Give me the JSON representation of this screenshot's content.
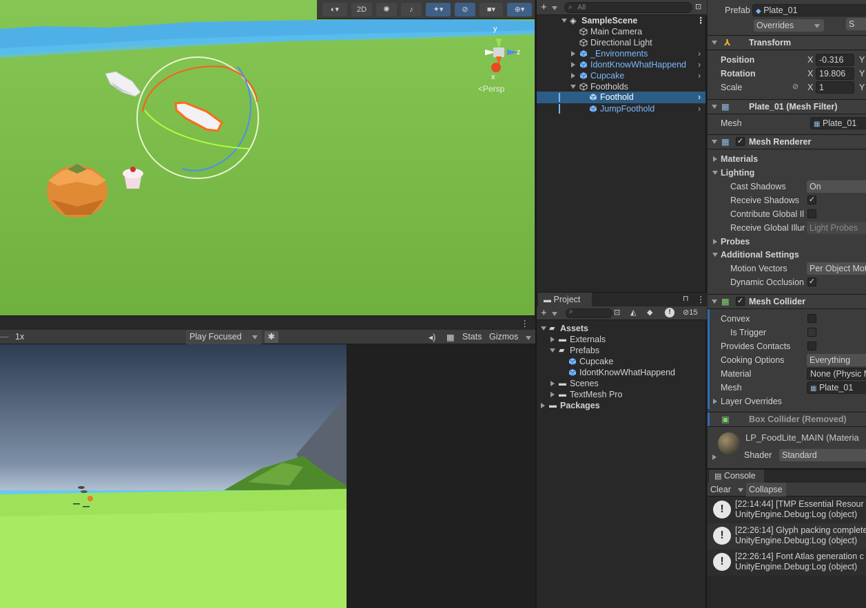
{
  "scene_toolbar": {
    "btn_2d": "2D",
    "hidden_count": "15"
  },
  "gizmo": {
    "y": "y",
    "z": "z",
    "x": "x",
    "persp": "<Persp"
  },
  "game_toolbar": {
    "scale": "1x",
    "play_mode": "Play Focused",
    "stats": "Stats",
    "gizmos": "Gizmos"
  },
  "hierarchy": {
    "search_placeholder": "All",
    "scene": "SampleScene",
    "items": [
      {
        "label": "Main Camera"
      },
      {
        "label": "Directional Light"
      },
      {
        "label": "_Environments"
      },
      {
        "label": "IdontKnowWhatHappend"
      },
      {
        "label": "Cupcake"
      },
      {
        "label": "Footholds"
      },
      {
        "label": "Foothold"
      },
      {
        "label": "JumpFoothold"
      }
    ]
  },
  "project": {
    "tab": "Project",
    "assets": "Assets",
    "externals": "Externals",
    "prefabs": "Prefabs",
    "cupcake": "Cupcake",
    "idontknow": "IdontKnowWhatHappend",
    "scenes": "Scenes",
    "textmeshpro": "TextMesh Pro",
    "packages": "Packages"
  },
  "inspector": {
    "prefab_label": "Prefab",
    "prefab_value": "Plate_01",
    "overrides": "Overrides",
    "transform": {
      "title": "Transform",
      "position": "Position",
      "rotation": "Rotation",
      "scale": "Scale",
      "x": "X",
      "y": "Y",
      "pos_x": "-0.316",
      "rot_x": "19.806",
      "scale_x": "1"
    },
    "mesh_filter": {
      "title": "Plate_01 (Mesh Filter)",
      "mesh": "Mesh",
      "mesh_value": "Plate_01"
    },
    "mesh_renderer": {
      "title": "Mesh Renderer",
      "materials": "Materials",
      "lighting": "Lighting",
      "cast_shadows": "Cast Shadows",
      "cast_value": "On",
      "receive_shadows": "Receive Shadows",
      "contribute_gi": "Contribute Global Il",
      "receive_gi": "Receive Global Illur",
      "receive_gi_value": "Light Probes",
      "probes": "Probes",
      "additional": "Additional Settings",
      "motion_vectors": "Motion Vectors",
      "motion_value": "Per Object Mot",
      "dynamic_occlusion": "Dynamic Occlusion"
    },
    "mesh_collider": {
      "title": "Mesh Collider",
      "convex": "Convex",
      "is_trigger": "Is Trigger",
      "provides_contacts": "Provides Contacts",
      "cooking_options": "Cooking Options",
      "cooking_value": "Everything",
      "material": "Material",
      "material_value": "None (Physic M",
      "mesh": "Mesh",
      "mesh_value": "Plate_01",
      "layer_overrides": "Layer Overrides"
    },
    "box_collider": "Box Collider (Removed)",
    "material": {
      "name": "LP_FoodLite_MAIN (Materia",
      "shader_label": "Shader",
      "shader_value": "Standard"
    }
  },
  "console": {
    "tab": "Console",
    "clear": "Clear",
    "collapse": "Collapse",
    "logs": [
      {
        "line1": "[22:14:44] [TMP Essential Resour",
        "line2": "UnityEngine.Debug:Log (object)"
      },
      {
        "line1": "[22:26:14] Glyph packing complete",
        "line2": "UnityEngine.Debug:Log (object)"
      },
      {
        "line1": "[22:26:14] Font Atlas generation c",
        "line2": "UnityEngine.Debug:Log (object)"
      }
    ]
  },
  "colors": {
    "selection": "#2c5d87",
    "prefab_blue": "#7ab7ff",
    "ground": "#7dbd4b",
    "water": "#4fb0e8"
  }
}
